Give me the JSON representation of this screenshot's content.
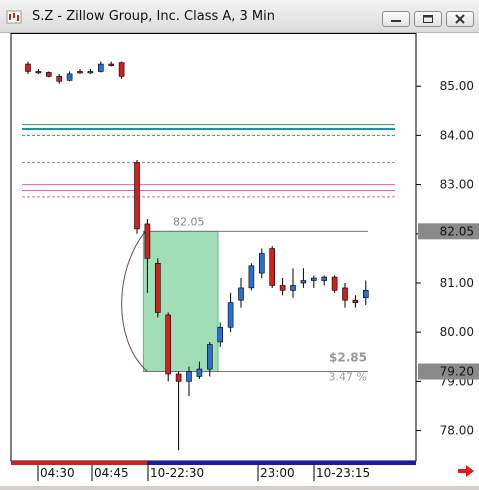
{
  "window": {
    "title": "S.Z - Zillow Group, Inc. Class A, 3 Min",
    "minimize_icon": "minimize-icon",
    "restore_icon": "restore-icon",
    "close_icon": "close-icon"
  },
  "chart_data": {
    "type": "candlestick",
    "symbol": "S.Z",
    "timeframe": "3 Min",
    "y_axis": {
      "ticks": [
        "85.00",
        "84.00",
        "83.00",
        "82.00",
        "81.00",
        "80.00",
        "79.00",
        "78.00"
      ],
      "tick_values": [
        85,
        84,
        83,
        82,
        81,
        80,
        79,
        78
      ],
      "range": [
        77.3,
        86.0
      ],
      "price_tags": [
        {
          "label": "82.05",
          "value": 82.05
        },
        {
          "label": "79.20",
          "value": 79.2
        }
      ]
    },
    "x_axis": {
      "labels": [
        "04:30",
        "04:45",
        "10-22:30",
        "23:00",
        "10-23:15"
      ]
    },
    "horizontal_levels": [
      {
        "value": 84.22,
        "color": "#2e9e4a"
      },
      {
        "value": 84.13,
        "color": "#1b8fb0"
      },
      {
        "value": 84.0,
        "color": "#2e9e4a",
        "style": "dashed"
      },
      {
        "value": 83.45,
        "color": "#999999",
        "style": "dashed"
      },
      {
        "value": 83.0,
        "color": "#e066a8"
      },
      {
        "value": 82.88,
        "color": "#e066a8"
      },
      {
        "value": 82.75,
        "color": "#e066a8",
        "style": "dashed"
      }
    ],
    "measure": {
      "high": 82.05,
      "low": 79.2,
      "high_label": "82.05",
      "low_label": "79.20",
      "change": "$2.85",
      "percent": "3.47 %",
      "box_color": "#7fd39f"
    },
    "candles": [
      {
        "o": 85.45,
        "h": 85.5,
        "l": 85.25,
        "c": 85.3
      },
      {
        "o": 85.3,
        "h": 85.35,
        "l": 85.25,
        "c": 85.28
      },
      {
        "o": 85.28,
        "h": 85.3,
        "l": 85.18,
        "c": 85.2
      },
      {
        "o": 85.2,
        "h": 85.25,
        "l": 85.05,
        "c": 85.1
      },
      {
        "o": 85.12,
        "h": 85.3,
        "l": 85.1,
        "c": 85.25
      },
      {
        "o": 85.3,
        "h": 85.35,
        "l": 85.25,
        "c": 85.28
      },
      {
        "o": 85.28,
        "h": 85.35,
        "l": 85.25,
        "c": 85.3
      },
      {
        "o": 85.3,
        "h": 85.5,
        "l": 85.28,
        "c": 85.45
      },
      {
        "o": 85.45,
        "h": 85.5,
        "l": 85.4,
        "c": 85.42
      },
      {
        "o": 85.48,
        "h": 85.5,
        "l": 85.15,
        "c": 85.2
      },
      {
        "o": 83.45,
        "h": 83.5,
        "l": 82.0,
        "c": 82.1
      },
      {
        "o": 82.2,
        "h": 82.3,
        "l": 80.8,
        "c": 81.5
      },
      {
        "o": 81.4,
        "h": 81.5,
        "l": 80.3,
        "c": 80.4
      },
      {
        "o": 80.35,
        "h": 80.4,
        "l": 79.0,
        "c": 79.15
      },
      {
        "o": 79.15,
        "h": 79.2,
        "l": 77.6,
        "c": 79.0
      },
      {
        "o": 79.0,
        "h": 79.3,
        "l": 78.7,
        "c": 79.2
      },
      {
        "o": 79.1,
        "h": 79.4,
        "l": 79.05,
        "c": 79.25
      },
      {
        "o": 79.25,
        "h": 79.8,
        "l": 79.1,
        "c": 79.75
      },
      {
        "o": 79.8,
        "h": 80.2,
        "l": 79.7,
        "c": 80.1
      },
      {
        "o": 80.1,
        "h": 80.8,
        "l": 80.0,
        "c": 80.6
      },
      {
        "o": 80.65,
        "h": 81.1,
        "l": 80.5,
        "c": 80.9
      },
      {
        "o": 80.9,
        "h": 81.4,
        "l": 80.85,
        "c": 81.35
      },
      {
        "o": 81.2,
        "h": 81.7,
        "l": 81.1,
        "c": 81.6
      },
      {
        "o": 81.7,
        "h": 81.75,
        "l": 80.9,
        "c": 80.95
      },
      {
        "o": 80.95,
        "h": 81.1,
        "l": 80.75,
        "c": 80.85
      },
      {
        "o": 80.85,
        "h": 81.3,
        "l": 80.7,
        "c": 80.95
      },
      {
        "o": 81.0,
        "h": 81.3,
        "l": 80.9,
        "c": 81.05
      },
      {
        "o": 81.05,
        "h": 81.15,
        "l": 80.9,
        "c": 81.1
      },
      {
        "o": 81.05,
        "h": 81.15,
        "l": 80.95,
        "c": 81.12
      },
      {
        "o": 81.12,
        "h": 81.15,
        "l": 80.8,
        "c": 80.85
      },
      {
        "o": 80.9,
        "h": 81.0,
        "l": 80.5,
        "c": 80.65
      },
      {
        "o": 80.65,
        "h": 80.75,
        "l": 80.5,
        "c": 80.6
      },
      {
        "o": 80.7,
        "h": 81.05,
        "l": 80.55,
        "c": 80.85
      }
    ],
    "up_color": "#2a6fd6",
    "down_color": "#d21f1f",
    "grid": false,
    "arrow_icon": "right-arrow-icon"
  }
}
